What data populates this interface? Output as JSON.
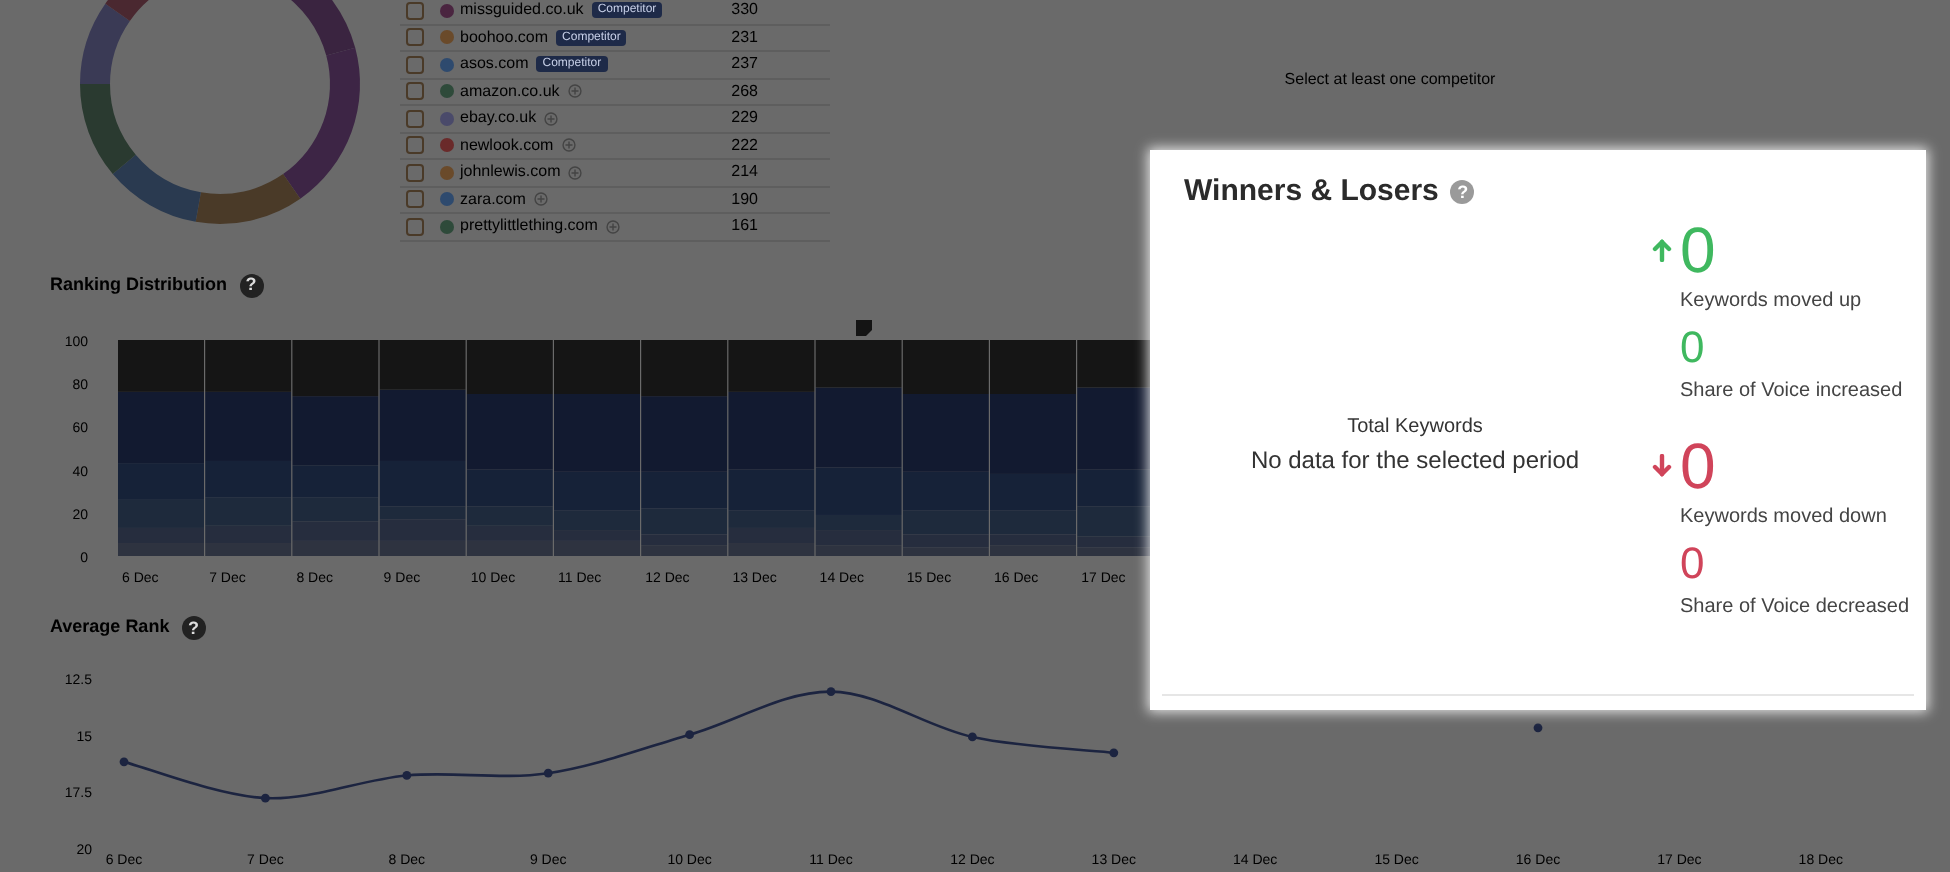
{
  "competitors": {
    "rows": [
      {
        "domain": "missguided.co.uk",
        "badge": "Competitor",
        "count": "330",
        "color": "#4a2540",
        "checked": false
      },
      {
        "domain": "boohoo.com",
        "badge": "Competitor",
        "count": "231",
        "color": "#6a4a2a",
        "checked": false
      },
      {
        "domain": "asos.com",
        "badge": "Competitor",
        "count": "237",
        "color": "#2e4a6e",
        "checked": false
      },
      {
        "domain": "amazon.co.uk",
        "count": "268",
        "color": "#2e4a3a",
        "checked": false
      },
      {
        "domain": "ebay.co.uk",
        "count": "229",
        "color": "#4a4a6a",
        "checked": false
      },
      {
        "domain": "newlook.com",
        "count": "222",
        "color": "#6a2a2a",
        "checked": false
      },
      {
        "domain": "johnlewis.com",
        "count": "214",
        "color": "#6a4a2a",
        "checked": false
      },
      {
        "domain": "zara.com",
        "count": "190",
        "color": "#2e4a6e",
        "checked": false
      },
      {
        "domain": "prettylittlething.com",
        "count": "161",
        "color": "#2e4a3a",
        "checked": false
      }
    ]
  },
  "comparison": {
    "empty_message": "Select at least one competitor"
  },
  "ranking_distribution": {
    "title": "Ranking Distribution",
    "help": "?",
    "chart_data": {
      "type": "bar",
      "stacked": true,
      "categories": [
        "6 Dec",
        "7 Dec",
        "8 Dec",
        "9 Dec",
        "10 Dec",
        "11 Dec",
        "12 Dec",
        "13 Dec",
        "14 Dec",
        "15 Dec",
        "16 Dec",
        "17 Dec"
      ],
      "yticks": [
        0,
        20,
        40,
        60,
        80,
        100
      ],
      "ylim": [
        0,
        100
      ],
      "series": [
        {
          "color": "#2e3340",
          "values": [
            6,
            6,
            7,
            7,
            7,
            7,
            5,
            6,
            5,
            4,
            5,
            4
          ]
        },
        {
          "color": "#262d3e",
          "values": [
            7,
            8,
            9,
            10,
            7,
            5,
            5,
            7,
            7,
            6,
            5,
            5
          ]
        },
        {
          "color": "#1e2a3c",
          "values": [
            13,
            13,
            11,
            6,
            9,
            9,
            12,
            8,
            7,
            11,
            11,
            14
          ]
        },
        {
          "color": "#162238",
          "values": [
            17,
            17,
            15,
            21,
            17,
            18,
            17,
            19,
            22,
            18,
            17,
            17
          ]
        },
        {
          "color": "#121a30",
          "values": [
            33,
            32,
            32,
            33,
            35,
            36,
            35,
            36,
            37,
            36,
            37,
            38
          ]
        },
        {
          "color": "#151515",
          "values": [
            24,
            24,
            26,
            23,
            25,
            25,
            26,
            24,
            22,
            25,
            25,
            22
          ]
        }
      ]
    }
  },
  "average_rank": {
    "title": "Average Rank",
    "help": "?",
    "chart_data": {
      "type": "line",
      "x": [
        "6 Dec",
        "7 Dec",
        "8 Dec",
        "9 Dec",
        "10 Dec",
        "11 Dec",
        "12 Dec",
        "13 Dec",
        "14 Dec",
        "15 Dec",
        "16 Dec",
        "17 Dec",
        "18 Dec"
      ],
      "ylim": [
        20,
        12.5
      ],
      "yticks": [
        {
          "value": 12.5,
          "label": "12.5"
        },
        {
          "value": 15,
          "label": "15"
        },
        {
          "value": 17.5,
          "label": "17.5"
        },
        {
          "value": 20,
          "label": "20"
        }
      ],
      "series": [
        {
          "color": "#1c2440",
          "marker": true,
          "values": [
            16.2,
            17.8,
            16.8,
            16.7,
            15,
            13.1,
            15.1,
            15.8,
            null,
            null,
            14.7,
            null,
            null
          ]
        }
      ]
    }
  },
  "winners_losers": {
    "title": "Winners & Losers",
    "help": "?",
    "total_label": "Total Keywords",
    "total_message": "No data for the selected period",
    "stats": [
      {
        "kind": "up",
        "value": "0",
        "label": "Keywords moved up"
      },
      {
        "kind": "plain_up",
        "value": "0",
        "label": "Share of Voice increased"
      },
      {
        "kind": "down",
        "value": "0",
        "label": "Keywords moved down"
      },
      {
        "kind": "plain_down",
        "value": "0",
        "label": "Share of Voice decreased"
      }
    ]
  }
}
